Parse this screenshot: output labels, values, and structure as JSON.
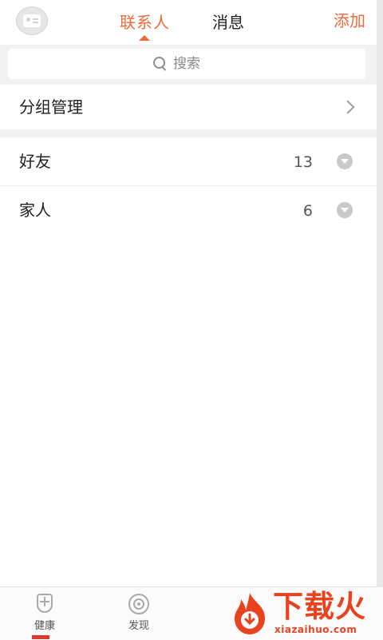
{
  "header": {
    "tabs": [
      {
        "label": "联系人",
        "active": true
      },
      {
        "label": "消息",
        "active": false
      }
    ],
    "add_label": "添加",
    "accent_color": "#ee6a3a"
  },
  "search": {
    "placeholder": "搜索",
    "icon": "search-icon"
  },
  "group_management": {
    "label": "分组管理",
    "icon": "chevron-right-icon"
  },
  "groups": [
    {
      "name": "好友",
      "count": "13"
    },
    {
      "name": "家人",
      "count": "6"
    }
  ],
  "bottom_nav": {
    "items": [
      {
        "label": "健康",
        "icon": "shield-icon"
      },
      {
        "label": "发现",
        "icon": "discover-icon"
      }
    ]
  },
  "watermark": {
    "text": "下载火",
    "domain": "xiazaihuo.com",
    "color": "#e8421f"
  }
}
